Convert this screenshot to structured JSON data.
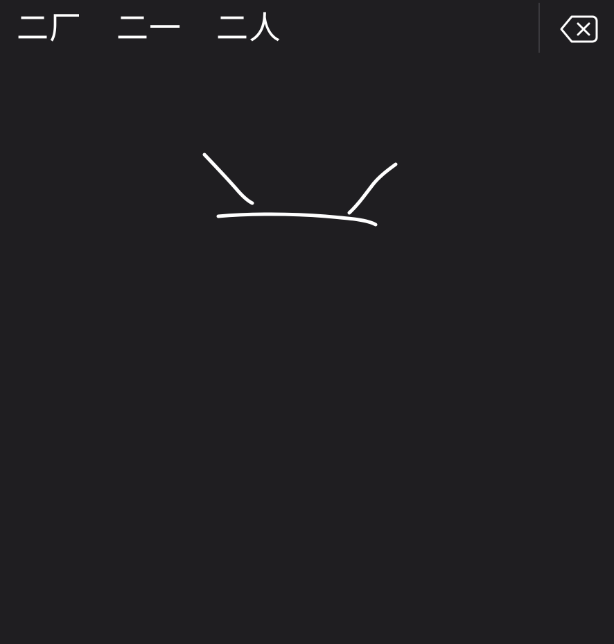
{
  "candidates": [
    {
      "text": "二厂"
    },
    {
      "text": "二一"
    },
    {
      "text": "二人"
    }
  ],
  "delete_key": {
    "icon": "delete-backward-icon"
  },
  "colors": {
    "background": "#1f1e21",
    "ink": "#ffffff",
    "divider": "#3a393d"
  }
}
